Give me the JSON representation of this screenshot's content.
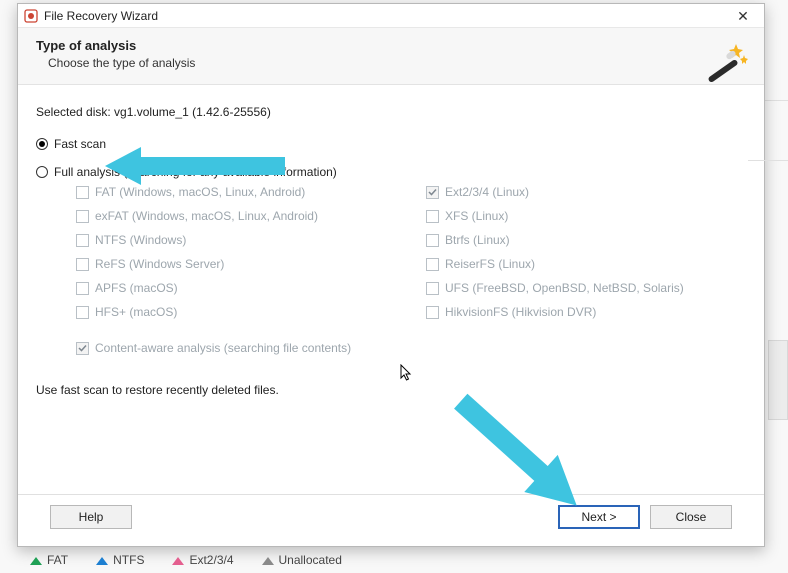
{
  "window": {
    "title": "File Recovery Wizard"
  },
  "header": {
    "title": "Type of analysis",
    "subtitle": "Choose the type of analysis"
  },
  "selected_disk_label": "Selected disk: vg1.volume_1 (1.42.6-25556)",
  "options": {
    "fast_scan": "Fast scan",
    "full_analysis": "Full analysis (searching for any available information)"
  },
  "filesystems_left": [
    "FAT (Windows, macOS, Linux, Android)",
    "exFAT (Windows, macOS, Linux, Android)",
    "NTFS (Windows)",
    "ReFS (Windows Server)",
    "APFS (macOS)",
    "HFS+ (macOS)"
  ],
  "filesystems_right": [
    "Ext2/3/4 (Linux)",
    "XFS (Linux)",
    "Btrfs (Linux)",
    "ReiserFS (Linux)",
    "UFS (FreeBSD, OpenBSD, NetBSD, Solaris)",
    "HikvisionFS (Hikvision DVR)"
  ],
  "content_aware": "Content-aware analysis (searching file contents)",
  "hint": "Use fast scan to restore recently deleted files.",
  "buttons": {
    "help": "Help",
    "next": "Next >",
    "close": "Close"
  },
  "legend": {
    "fat": "FAT",
    "ntfs": "NTFS",
    "ext": "Ext2/3/4",
    "unalloc": "Unallocated"
  }
}
